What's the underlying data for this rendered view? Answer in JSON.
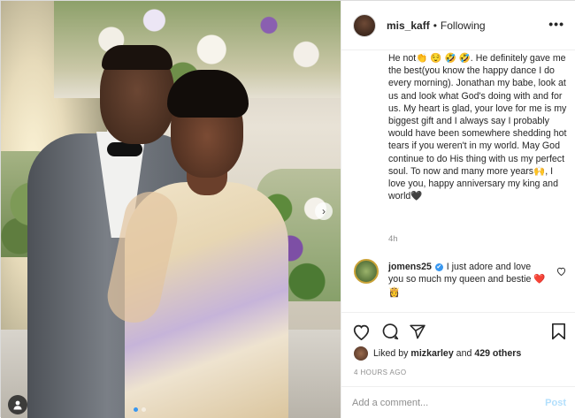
{
  "post": {
    "username": "mis_kaff",
    "separator": "•",
    "follow_status": "Following",
    "more_icon": "more-options-icon"
  },
  "caption": {
    "text": "He not👏 😌 🤣 🤣. He definitely gave me the best(you know the happy dance I do every morning). Jonathan my babe, look at us and look what God's doing with and for us. My heart is glad, your love for me is my biggest gift and I always say I probably would have been somewhere shedding hot tears if you weren't in my world. May God continue to do His thing with us my perfect soul. To now and many more years🙌, I love you, happy anniversary my king and world🖤",
    "time": "4h"
  },
  "comment": {
    "username": "jomens25",
    "verified_icon": "✔",
    "text": "I just adore and love you so much my queen and bestie ❤️ 👸"
  },
  "actions": {
    "like_icon": "heart-icon",
    "comment_icon": "comment-icon",
    "share_icon": "share-icon",
    "save_icon": "bookmark-icon"
  },
  "likes": {
    "prefix": "Liked by",
    "user": "mizkarley",
    "conjunction": "and",
    "others": "429 others"
  },
  "timestamp": "4 HOURS AGO",
  "add_comment": {
    "placeholder": "Add a comment...",
    "post_label": "Post"
  },
  "colors": {
    "accent": "#3897f0",
    "post_disabled": "#b2dffc",
    "secondary_text": "#8e8e8e",
    "heart_red": "#ed4956"
  }
}
